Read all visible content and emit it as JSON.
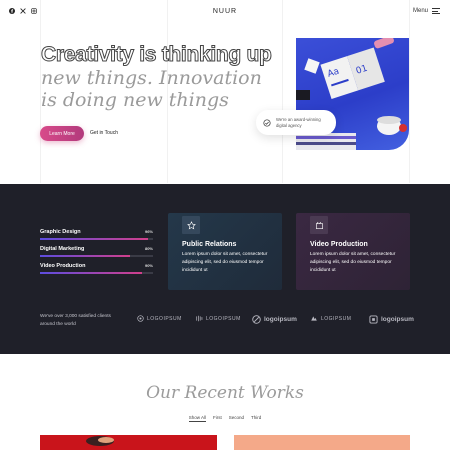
{
  "header": {
    "logo": "NUUR",
    "menu_label": "Menu",
    "social": [
      "facebook-icon",
      "x-icon",
      "instagram-icon"
    ]
  },
  "hero": {
    "line1": "Creativity is thinking up",
    "line2": "new things. Innovation is doing new things",
    "primary_button": "Learn More",
    "secondary_link": "Get in Touch",
    "award_text": "We're an award-winning digital agency"
  },
  "skills": [
    {
      "label": "Graphic Design",
      "percent_text": "96%",
      "level": 0.96
    },
    {
      "label": "Digital Marketing",
      "percent_text": "80%",
      "level": 0.8
    },
    {
      "label": "Video Production",
      "percent_text": "90%",
      "level": 0.9
    }
  ],
  "services": [
    {
      "title": "Public Relations",
      "text": "Lorem ipsum dolor sit amet, consectetur adipiscing elit, sed do eiusmod tempor incididunt ut",
      "icon": "star-icon"
    },
    {
      "title": "Video Production",
      "text": "Lorem ipsum dolor sit amet, consectetur adipiscing elit, sed do eiusmod tempor incididunt ut",
      "icon": "video-icon"
    }
  ],
  "clients_text": "We've over 3,000 satisfied clients around the world",
  "client_logos": [
    "LOGOIPSUM",
    "LOGOIPSUM",
    "logoipsum",
    "LOGIPSUM",
    "logoipsum"
  ],
  "works": {
    "title": "Our Recent Works",
    "tabs": [
      "Show All",
      "First",
      "Second",
      "Third"
    ],
    "active_tab": "Show All"
  },
  "colors": {
    "dark_bg": "#1f2029",
    "accent_pink": "#d84a8a",
    "hero_blue": "#2c3ec9"
  }
}
